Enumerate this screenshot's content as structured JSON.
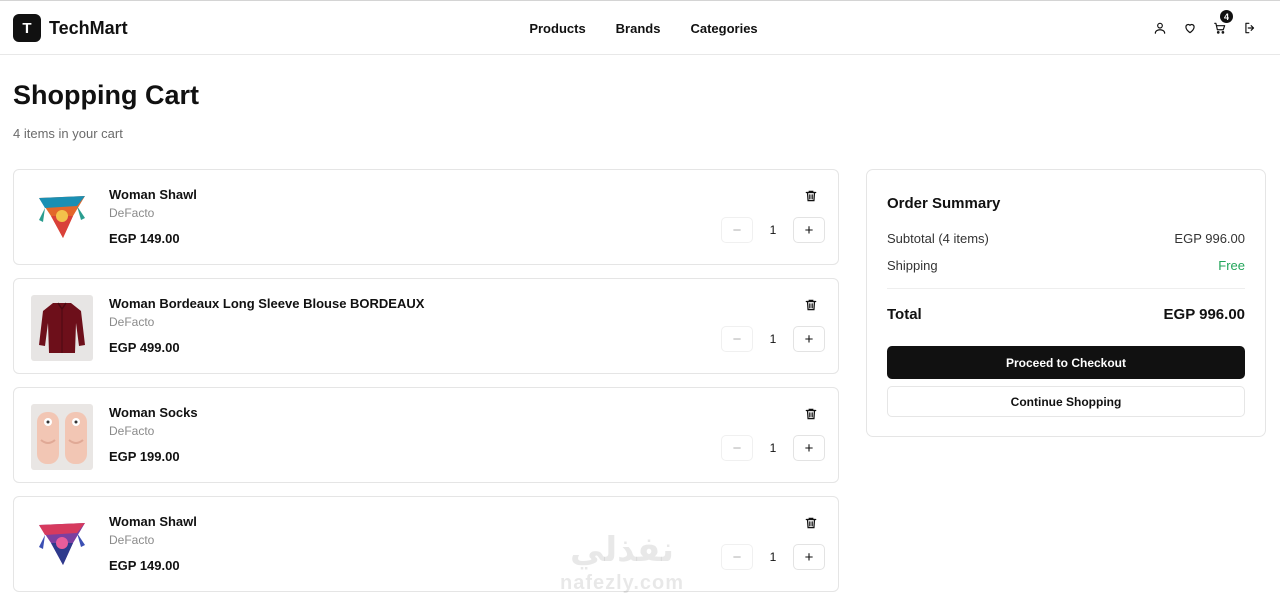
{
  "header": {
    "logo_letter": "T",
    "brand": "TechMart",
    "nav": [
      "Products",
      "Brands",
      "Categories"
    ],
    "cart_count": "4"
  },
  "page": {
    "title": "Shopping Cart",
    "subtitle": "4 items in your cart"
  },
  "cart": {
    "items": [
      {
        "name": "Woman Shawl",
        "brand": "DeFacto",
        "price": "EGP 149.00",
        "qty": "1"
      },
      {
        "name": "Woman Bordeaux Long Sleeve Blouse BORDEAUX",
        "brand": "DeFacto",
        "price": "EGP 499.00",
        "qty": "1"
      },
      {
        "name": "Woman Socks",
        "brand": "DeFacto",
        "price": "EGP 199.00",
        "qty": "1"
      },
      {
        "name": "Woman Shawl",
        "brand": "DeFacto",
        "price": "EGP 149.00",
        "qty": "1"
      }
    ]
  },
  "summary": {
    "title": "Order Summary",
    "subtotal_label": "Subtotal (4 items)",
    "subtotal_value": "EGP 996.00",
    "shipping_label": "Shipping",
    "shipping_value": "Free",
    "total_label": "Total",
    "total_value": "EGP 996.00",
    "checkout_label": "Proceed to Checkout",
    "continue_label": "Continue Shopping"
  },
  "watermark": {
    "logo": "نفذلي",
    "text": "nafezly.com"
  },
  "colors": {
    "primary": "#111111",
    "free": "#22a55a",
    "muted": "#8a8a8a"
  }
}
